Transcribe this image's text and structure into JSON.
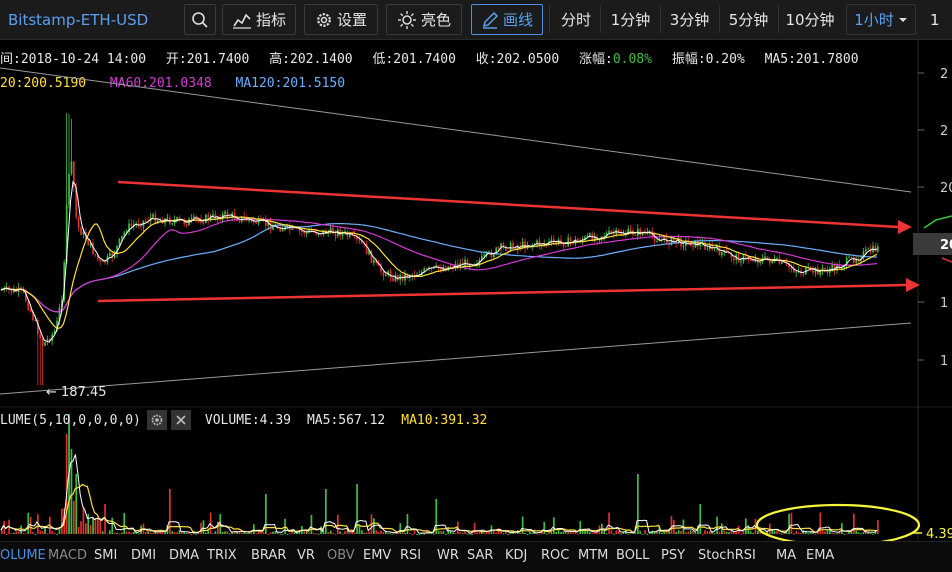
{
  "toolbar": {
    "symbol": "Bitstamp-ETH-USD",
    "indicators_label": "指标",
    "settings_label": "设置",
    "theme_label": "亮色",
    "draw_label": "画线",
    "intervals": [
      "分时",
      "1分钟",
      "3分钟",
      "5分钟",
      "10分钟"
    ],
    "active_interval": "1小时",
    "right_partial": "1"
  },
  "info_bar": {
    "time": "间:2018-10-24 14:00",
    "open": "开:201.7400",
    "high": "高:202.1400",
    "low": "低:201.7400",
    "close": "收:202.0500",
    "change_label": "涨幅:",
    "change_value": "0.08%",
    "amplitude": "振幅:0.20%",
    "ma5": "MA5:201.7800"
  },
  "ma_bar": {
    "ma20": "20:200.5190",
    "ma60": "MA60:201.0348",
    "ma120": "MA120:201.5150"
  },
  "price_axis": {
    "partial_labels": [
      "2",
      "2",
      "20",
      "1",
      "1"
    ],
    "current_price_partial": "20"
  },
  "low_marker": "← 187.45",
  "volume_bar": {
    "title": "LUME(5,10,0,0,0,0)",
    "volume": "VOLUME:4.39",
    "ma5": "MA5:567.12",
    "ma10": "MA10:391.32",
    "current_partial": "4.39"
  },
  "indicators": [
    "OLUME",
    "MACD",
    "SMI",
    "DMI",
    "DMA",
    "TRIX",
    "BRAR",
    "VR",
    "OBV",
    "EMV",
    "RSI",
    "WR",
    "SAR",
    "KDJ",
    "ROC",
    "MTM",
    "BOLL",
    "PSY",
    "StochRSI",
    "MA",
    "EMA"
  ],
  "colors": {
    "up": "#3fbf3f",
    "down": "#e0302f",
    "ma5": "#ffffff",
    "ma10": "#ffe13a",
    "ma60": "#d63ad6",
    "ma120": "#6ab0ff",
    "accent": "#4a90e2",
    "annotation_red": "#ee3333",
    "annotation_yellow": "#f5f53a"
  }
}
